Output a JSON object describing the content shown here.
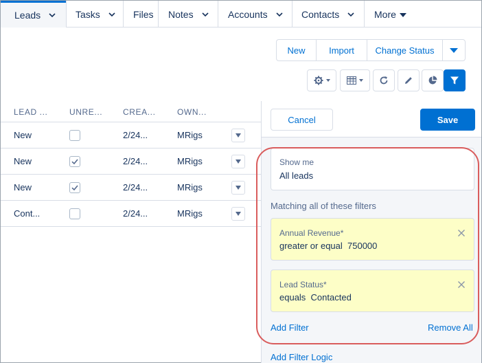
{
  "nav": {
    "tabs": [
      {
        "label": "Leads",
        "has_menu": true,
        "active": true
      },
      {
        "label": "Tasks",
        "has_menu": true
      },
      {
        "label": "Files",
        "has_menu": false
      },
      {
        "label": "Notes",
        "has_menu": true
      },
      {
        "label": "Accounts",
        "has_menu": true
      },
      {
        "label": "Contacts",
        "has_menu": true
      }
    ],
    "more_label": "More"
  },
  "actions": {
    "new_label": "New",
    "import_label": "Import",
    "change_status_label": "Change Status",
    "menu_icon": "chevron-down-icon"
  },
  "toolbar_icons": [
    "gear-icon",
    "table-icon",
    "refresh-icon",
    "pencil-icon",
    "pie-chart-icon",
    "filter-icon"
  ],
  "table": {
    "columns": [
      "LEAD ...",
      "UNRE...",
      "CREA...",
      "OWN..."
    ],
    "rows": [
      {
        "status": "New",
        "unread": false,
        "created": "2/24...",
        "owner": "MRigs"
      },
      {
        "status": "New",
        "unread": true,
        "created": "2/24...",
        "owner": "MRigs"
      },
      {
        "status": "New",
        "unread": true,
        "created": "2/24...",
        "owner": "MRigs"
      },
      {
        "status": "Cont...",
        "unread": false,
        "created": "2/24...",
        "owner": "MRigs"
      }
    ]
  },
  "filter_panel": {
    "cancel_label": "Cancel",
    "save_label": "Save",
    "show_me_label": "Show me",
    "show_me_value": "All leads",
    "matching_label": "Matching all of these filters",
    "filters": [
      {
        "field": "Annual Revenue*",
        "condition": "greater or equal  750000"
      },
      {
        "field": "Lead Status*",
        "condition": "equals  Contacted"
      }
    ],
    "add_filter_label": "Add Filter",
    "remove_all_label": "Remove All",
    "add_filter_logic_label": "Add Filter Logic"
  },
  "colors": {
    "brand": "#0070d2",
    "filter_card": "#fdfec7",
    "highlight": "#d95c5c"
  }
}
